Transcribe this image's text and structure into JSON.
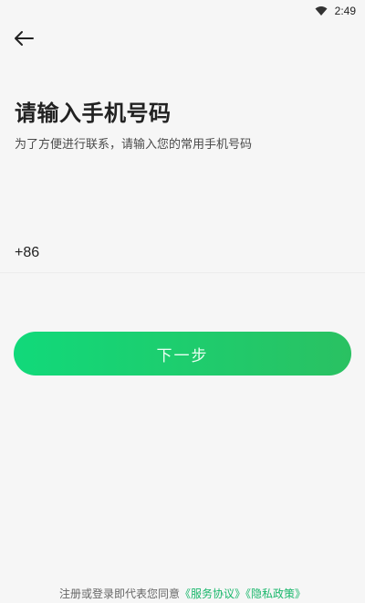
{
  "status_bar": {
    "time": "2:49",
    "icons": [
      "wifi-icon"
    ]
  },
  "header": {
    "back_icon": "arrow-left-icon"
  },
  "main": {
    "title": "请输入手机号码",
    "subtitle": "为了方便进行联系，请输入您的常用手机号码",
    "phone": {
      "country_code": "+86",
      "value": "",
      "placeholder": ""
    },
    "next_button": "下一步"
  },
  "footer": {
    "prefix": "注册或登录即代表您同意",
    "service_agreement": "《服务协议》",
    "privacy_policy": "《隐私政策》"
  },
  "colors": {
    "accent_start": "#11d97a",
    "accent_end": "#2ac162",
    "link": "#19b76b",
    "background": "#f6f6f6"
  }
}
